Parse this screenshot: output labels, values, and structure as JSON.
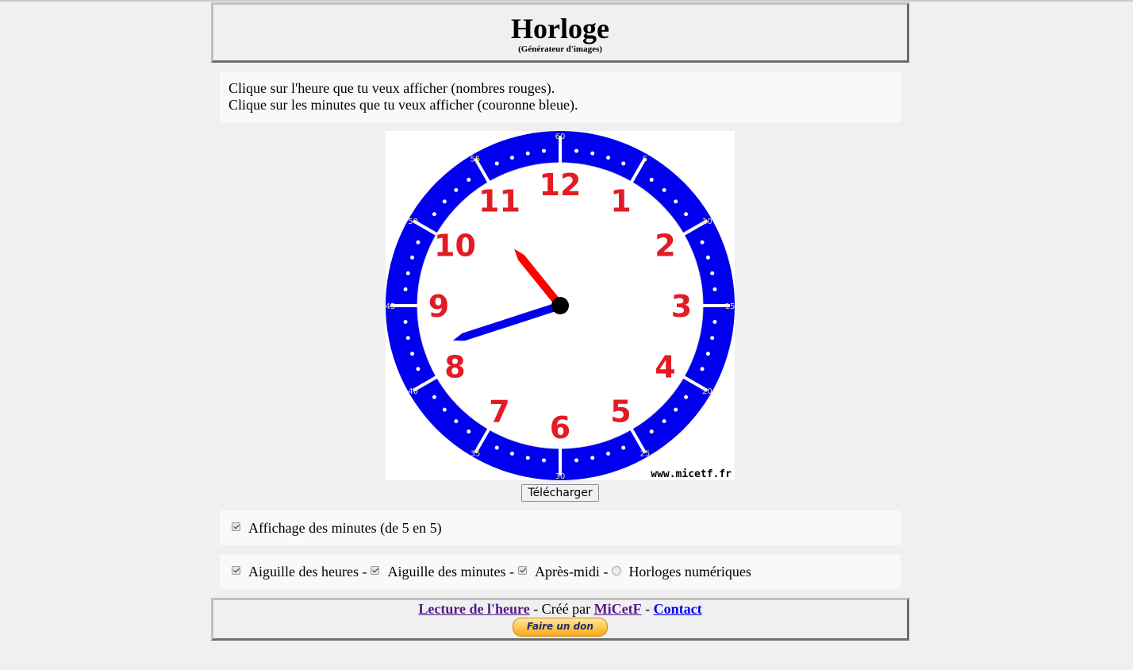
{
  "header": {
    "title": "Horloge",
    "subtitle": "(Générateur d'images)"
  },
  "instructions": {
    "line1": "Clique sur l'heure que tu veux afficher (nombres rouges).",
    "line2": "Clique sur les minutes que tu veux afficher (couronne bleue)."
  },
  "clock": {
    "hour_numbers": [
      "12",
      "1",
      "2",
      "3",
      "4",
      "5",
      "6",
      "7",
      "8",
      "9",
      "10",
      "11"
    ],
    "minute_numbers": [
      "60",
      "5",
      "10",
      "15",
      "20",
      "25",
      "30",
      "35",
      "40",
      "45",
      "50",
      "55"
    ],
    "watermark": "www.micetf.fr",
    "hour_hand_value": 10.7,
    "minute_hand_value": 42,
    "colors": {
      "ring": "#0000ee",
      "hour_numbers": "#e31b23",
      "hour_hand": "#ff0000",
      "minute_hand": "#0000ee",
      "center": "#000000"
    }
  },
  "download_button": "Télécharger",
  "options": {
    "minutes_display": {
      "label": "Affichage des minutes (de 5 en 5)",
      "checked": true
    },
    "hour_hand": {
      "label": "Aiguille des heures -",
      "checked": true
    },
    "minute_hand": {
      "label": "Aiguille des minutes -",
      "checked": true
    },
    "afternoon": {
      "label": "Après-midi -",
      "checked": true
    },
    "digital": {
      "label": "Horloges numériques",
      "checked": false
    }
  },
  "footer": {
    "link1": "Lecture de l'heure",
    "sep1": " - Créé par ",
    "link2": "MiCetF",
    "sep2": " - ",
    "link3": "Contact",
    "donate": "Faire un don"
  }
}
